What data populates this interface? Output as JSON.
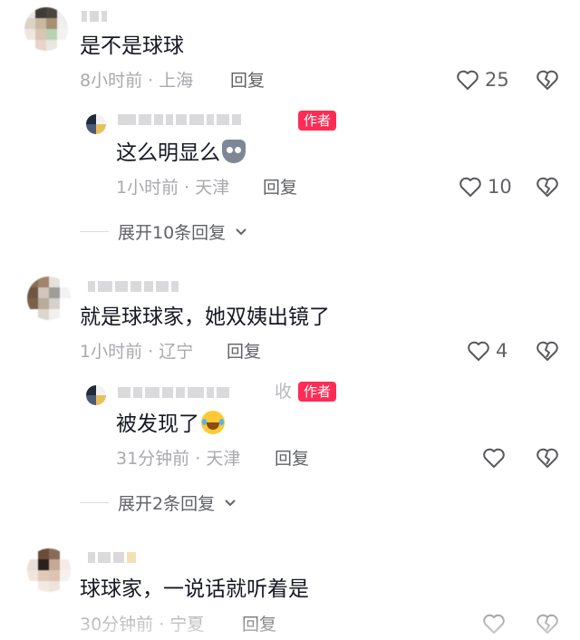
{
  "comments": [
    {
      "text": "是不是球球",
      "time": "8小时前",
      "location": "上海",
      "reply_label": "回复",
      "likes": "25",
      "author_reply": {
        "text": "这么明显么",
        "emoji": "dog-face-emoji",
        "time": "1小时前",
        "location": "天津",
        "reply_label": "回复",
        "likes": "10",
        "author_tag": "作者"
      },
      "expand_label": "展开10条回复"
    },
    {
      "text": "就是球球家，她双姨出镜了",
      "time": "1小时前",
      "location": "辽宁",
      "reply_label": "回复",
      "likes": "4",
      "author_reply": {
        "name_tail": "收",
        "text": "被发现了",
        "emoji": "laughing-crying-emoji",
        "time": "31分钟前",
        "location": "天津",
        "reply_label": "回复",
        "likes": "",
        "author_tag": "作者"
      },
      "expand_label": "展开2条回复"
    },
    {
      "text": "球球家，一说话就听着是",
      "time": "30分钟前",
      "location": "宁夏",
      "reply_label": "回复",
      "likes": ""
    }
  ],
  "separator": " · ",
  "icons": {
    "like": "heart-outline-icon",
    "dislike": "broken-heart-icon",
    "expand": "chevron-down-icon"
  },
  "colors": {
    "author_tag": "#fe2c55",
    "meta": "#a8a9ad",
    "text": "#161823"
  }
}
